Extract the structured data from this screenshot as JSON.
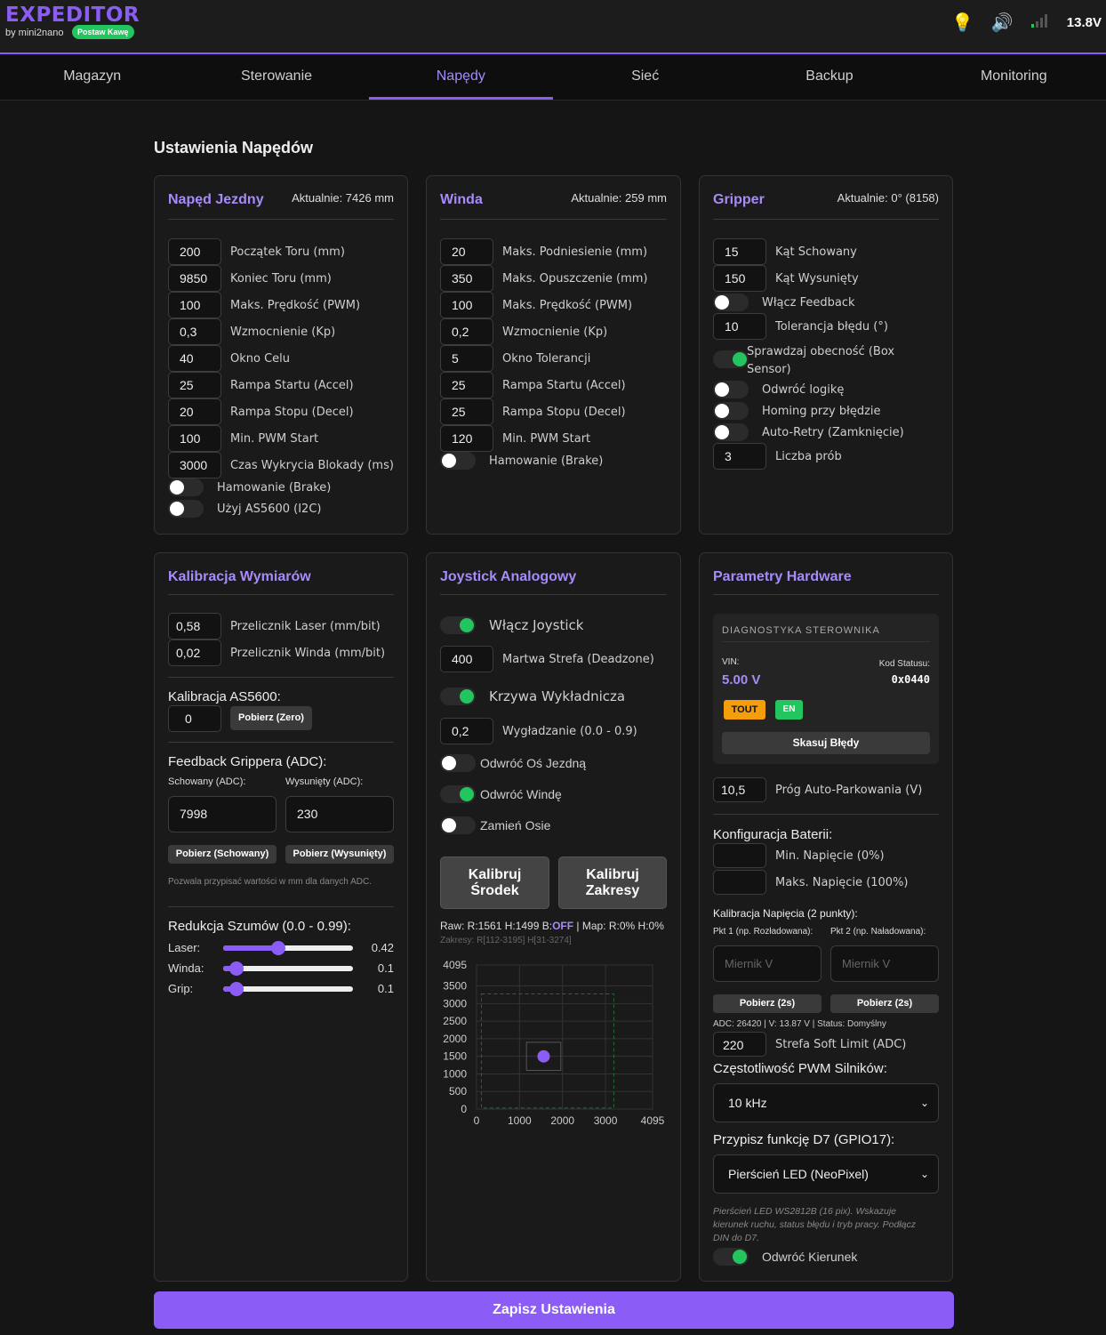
{
  "header": {
    "logo": "EXPEDITOR",
    "byline": "by mini2nano",
    "coffee": "Postaw Kawę",
    "voltage": "13.8V",
    "icons": [
      "lightbulb-icon",
      "speaker-icon",
      "signal-icon"
    ]
  },
  "nav": {
    "tabs": [
      "Magazyn",
      "Sterowanie",
      "Napędy",
      "Sieć",
      "Backup",
      "Monitoring"
    ],
    "active": 2
  },
  "page": {
    "title": "Ustawienia Napędów",
    "save": "Zapisz Ustawienia"
  },
  "drive": {
    "title": "Napęd Jezdny",
    "now": "Aktualnie: 7426 mm",
    "rows": [
      {
        "v": "200",
        "l": "Początek Toru (mm)"
      },
      {
        "v": "9850",
        "l": "Koniec Toru (mm)"
      },
      {
        "v": "100",
        "l": "Maks. Prędkość (PWM)"
      },
      {
        "v": "0,3",
        "l": "Wzmocnienie (Kp)"
      },
      {
        "v": "40",
        "l": "Okno Celu"
      },
      {
        "v": "25",
        "l": "Rampa Startu (Accel)"
      },
      {
        "v": "20",
        "l": "Rampa Stopu (Decel)"
      },
      {
        "v": "100",
        "l": "Min. PWM Start"
      },
      {
        "v": "3000",
        "l": "Czas Wykrycia Blokady (ms)"
      }
    ],
    "toggles": [
      {
        "l": "Hamowanie (Brake)",
        "on": false
      },
      {
        "l": "Użyj AS5600 (I2C)",
        "on": false
      }
    ]
  },
  "winch": {
    "title": "Winda",
    "now": "Aktualnie: 259 mm",
    "rows": [
      {
        "v": "20",
        "l": "Maks. Podniesienie (mm)"
      },
      {
        "v": "350",
        "l": "Maks. Opuszczenie (mm)"
      },
      {
        "v": "100",
        "l": "Maks. Prędkość (PWM)"
      },
      {
        "v": "0,2",
        "l": "Wzmocnienie (Kp)"
      },
      {
        "v": "5",
        "l": "Okno Tolerancji"
      },
      {
        "v": "25",
        "l": "Rampa Startu (Accel)"
      },
      {
        "v": "25",
        "l": "Rampa Stopu (Decel)"
      },
      {
        "v": "120",
        "l": "Min. PWM Start"
      }
    ],
    "toggles": [
      {
        "l": "Hamowanie (Brake)",
        "on": false
      }
    ]
  },
  "gripper": {
    "title": "Gripper",
    "now": "Aktualnie: 0° (8158)",
    "angle_hidden": {
      "v": "15",
      "l": "Kąt Schowany"
    },
    "angle_out": {
      "v": "150",
      "l": "Kąt Wysunięty"
    },
    "feedback": {
      "l": "Włącz Feedback",
      "on": false
    },
    "tolerance": {
      "v": "10",
      "l": "Tolerancja błędu (°)"
    },
    "box": {
      "l": "Sprawdzaj obecność (Box Sensor)",
      "l1": "Sprawdzaj obecność (Box",
      "l2": "Sensor)",
      "on": true
    },
    "invert": {
      "l": "Odwróć logikę",
      "on": false
    },
    "homing": {
      "l": "Homing przy błędzie",
      "on": false
    },
    "retry": {
      "l": "Auto-Retry (Zamknięcie)",
      "on": false
    },
    "tries": {
      "v": "3",
      "l": "Liczba prób"
    }
  },
  "calib": {
    "title": "Kalibracja Wymiarów",
    "laser": {
      "v": "0,58",
      "l": "Przelicznik Laser (mm/bit)"
    },
    "winch": {
      "v": "0,02",
      "l": "Przelicznik Winda (mm/bit)"
    },
    "as_title": "Kalibracja AS5600:",
    "as_value": "0",
    "as_btn": "Pobierz (Zero)",
    "fb_title": "Feedback Grippera (ADC):",
    "fb_hidden_label": "Schowany (ADC):",
    "fb_out_label": "Wysunięty (ADC):",
    "fb_hidden": "7998",
    "fb_out": "230",
    "fb_btn_hidden": "Pobierz (Schowany)",
    "fb_btn_out": "Pobierz (Wysunięty)",
    "fb_note": "Pozwala przypisać wartości w mm dla danych ADC.",
    "noise_title": "Redukcja Szumów (0.0 - 0.99):",
    "sliders": [
      {
        "l": "Laser:",
        "v": 0.42,
        "t": "0.42"
      },
      {
        "l": "Winda:",
        "v": 0.1,
        "t": "0.1"
      },
      {
        "l": "Grip:",
        "v": 0.1,
        "t": "0.1"
      }
    ]
  },
  "joy": {
    "title": "Joystick Analogowy",
    "enable": {
      "l": "Włącz Joystick",
      "on": true
    },
    "deadzone": {
      "v": "400",
      "l": "Martwa Strefa (Deadzone)"
    },
    "expo": {
      "l": "Krzywa Wykładnicza",
      "on": true
    },
    "smooth": {
      "v": "0,2",
      "l": "Wygładzanie (0.0 - 0.9)"
    },
    "inv_drive": {
      "l": "Odwróć Oś Jezdną",
      "on": false
    },
    "inv_winch": {
      "l": "Odwróć Windę",
      "on": true
    },
    "swap": {
      "l": "Zamień Osie",
      "on": false
    },
    "btn_center_1": "Kalibruj",
    "btn_center_2": "Środek",
    "btn_range_1": "Kalibruj",
    "btn_range_2": "Zakresy",
    "raw_text": "Raw: R:1561 H:1499 B:",
    "raw_b": "OFF",
    "raw_map": " | Map: R:0% H:0%",
    "ranges": "Zakresy: R[112-3195] H[31-3274]"
  },
  "chart_data": {
    "type": "scatter",
    "x": [
      1561
    ],
    "y": [
      1499
    ],
    "xlim": [
      0,
      4095
    ],
    "ylim": [
      0,
      4095
    ],
    "xticks": [
      0,
      1000,
      2000,
      3000,
      4095
    ],
    "yticks": [
      0,
      500,
      1000,
      1500,
      2000,
      2500,
      3000,
      3500,
      4095
    ],
    "range_x": [
      112,
      3195
    ],
    "range_y": [
      31,
      3274
    ],
    "center_x": 1561,
    "center_y": 1499,
    "deadzone": 400,
    "grid": true,
    "point_color": "#8b5cf6"
  },
  "hw": {
    "title": "Parametry Hardware",
    "diag_title": "DIAGNOSTYKA STEROWNIKA",
    "vin_label": "VIN:",
    "vin": "5.00 V",
    "status_label": "Kod Statusu:",
    "status": "0x0440",
    "badge_tout": "TOUT",
    "badge_en": "EN",
    "clear": "Skasuj Błędy",
    "park": {
      "v": "10,5",
      "l": "Próg Auto-Parkowania (V)"
    },
    "bat_title": "Konfiguracja Baterii:",
    "bat_min": {
      "v": "",
      "l": "Min. Napięcie (0%)"
    },
    "bat_max": {
      "v": "",
      "l": "Maks. Napięcie (100%)"
    },
    "vcal_title": "Kalibracja Napięcia (2 punkty):",
    "p1_label": "Pkt 1 (np. Rozładowana):",
    "p2_label": "Pkt 2 (np. Naładowana):",
    "meter_ph": "Miernik V",
    "grab": "Pobierz (2s)",
    "adc_line": "ADC: 26420 | V: 13.87 V | Status: Domyślny",
    "soft": {
      "v": "220",
      "l": "Strefa Soft Limit (ADC)"
    },
    "pwm_title": "Częstotliwość PWM Silników:",
    "pwm": "10 kHz",
    "d7_title": "Przypisz funkcję D7 (GPIO17):",
    "d7": "Pierścień LED (NeoPixel)",
    "d7_note_1": "Pierścień LED WS2812B (16 pix). Wskazuje",
    "d7_note_2": "kierunek ruchu, status błędu i tryb pracy. Podłącz",
    "d7_note_3": "DIN do D7.",
    "reverse": {
      "l": "Odwróć Kierunek",
      "on": true
    }
  },
  "colors": {
    "accent": "#8b5cf6",
    "on": "#22c55e",
    "warn": "#f59e0b"
  }
}
